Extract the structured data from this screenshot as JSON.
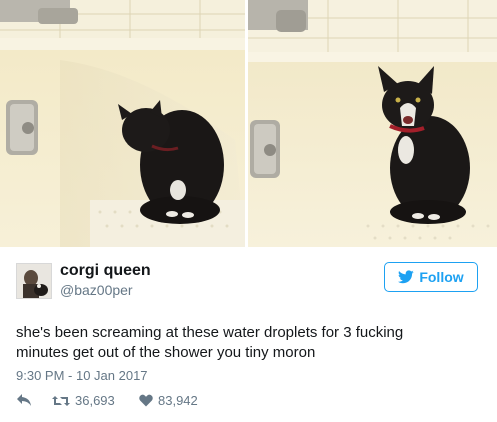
{
  "tweet": {
    "display_name": "corgi queen",
    "handle": "@baz00per",
    "follow_label": "Follow",
    "text_line1": "she's been screaming at these water droplets for 3 fucking",
    "text_line2": "minutes get out of the shower you tiny moron",
    "timestamp": "9:30 PM - 10 Jan 2017",
    "retweets": "36,693",
    "likes": "83,942"
  },
  "colors": {
    "accent": "#1da1f2",
    "secondary_text": "#657786",
    "primary_text": "#14171a"
  },
  "icons": [
    "twitter-bird-icon",
    "reply-icon",
    "retweet-icon",
    "heart-icon"
  ]
}
